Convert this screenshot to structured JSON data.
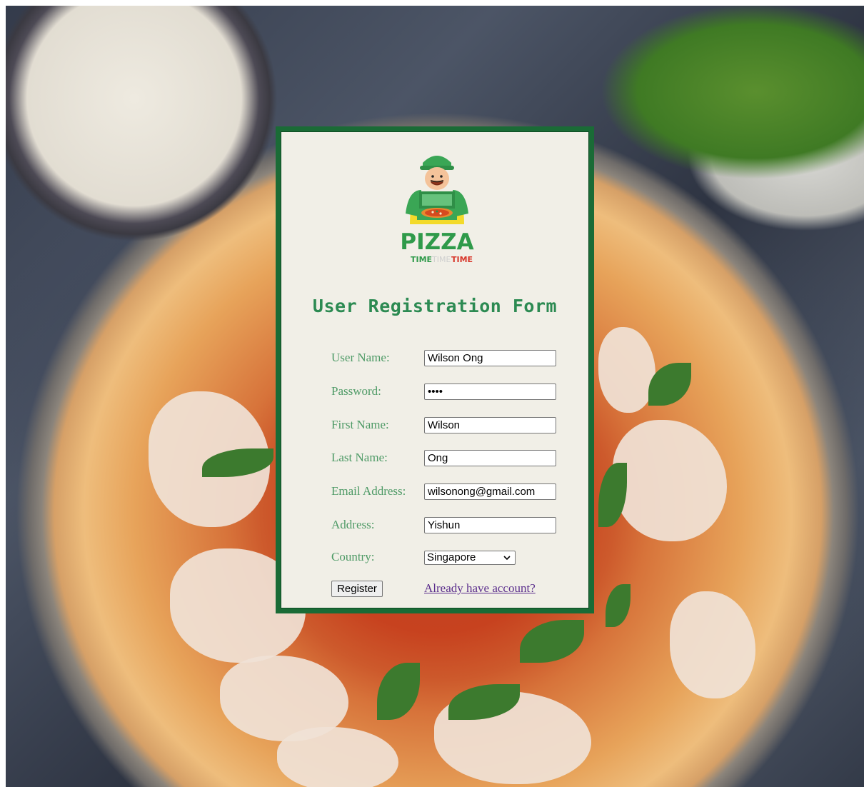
{
  "brand": {
    "logo_word": "PIZZA",
    "logo_tagline": [
      "TIME",
      "TIME",
      "TIME"
    ]
  },
  "form": {
    "title": "User Registration Form",
    "fields": {
      "username": {
        "label": "User Name:",
        "value": "Wilson Ong"
      },
      "password": {
        "label": "Password:",
        "value": "••••"
      },
      "first_name": {
        "label": "First Name:",
        "value": "Wilson"
      },
      "last_name": {
        "label": "Last Name:",
        "value": "Ong"
      },
      "email": {
        "label": "Email Address:",
        "value": "wilsonong@gmail.com"
      },
      "address": {
        "label": "Address:",
        "value": "Yishun"
      }
    },
    "country": {
      "label": "Country:",
      "selected": "Singapore"
    },
    "register_label": "Register",
    "login_link": "Already have account?"
  },
  "colors": {
    "card_border": "#1a6b36",
    "title": "#2c8a52",
    "label": "#4e9a66",
    "link": "#5b2e8c"
  },
  "icons": {
    "select": "chevron-down-icon"
  }
}
